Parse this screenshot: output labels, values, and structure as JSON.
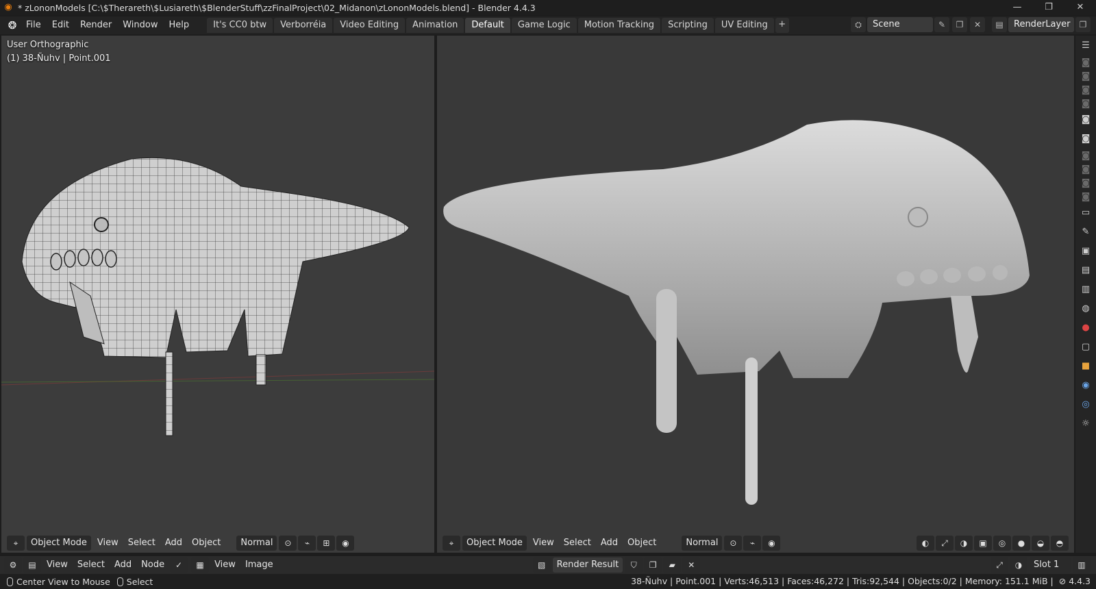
{
  "window": {
    "title": "* zLononModels [C:\\$Therareth\\$Lusiareth\\$BlenderStuff\\zzFinalProject\\02_Midanon\\zLononModels.blend] - Blender 4.4.3",
    "controls": [
      "—",
      "❐",
      "✕"
    ]
  },
  "menu": {
    "items": [
      "File",
      "Edit",
      "Render",
      "Window",
      "Help"
    ]
  },
  "workspaces": {
    "tabs": [
      "It's CC0 btw",
      "Verborréia",
      "Video Editing",
      "Animation",
      "Default",
      "Game Logic",
      "Motion Tracking",
      "Scripting",
      "UV Editing"
    ],
    "active": "Default",
    "add_label": "+"
  },
  "scene": {
    "name": "Scene"
  },
  "render_layer": {
    "name": "RenderLayer"
  },
  "viewport_left": {
    "view_name": "User Orthographic",
    "object_info": "(1) 38-Ñuhv | Point.001",
    "mode": "Object Mode",
    "menus": [
      "View",
      "Select",
      "Add",
      "Object"
    ],
    "orientation": "Normal"
  },
  "viewport_right": {
    "mode": "Object Mode",
    "menus": [
      "View",
      "Select",
      "Add",
      "Object"
    ],
    "orientation": "Normal"
  },
  "editor_bar": {
    "node_menus": [
      "View",
      "Select",
      "Add",
      "Node"
    ],
    "image_menus": [
      "View",
      "Image"
    ],
    "render_result": "Render Result",
    "slot": "Slot 1"
  },
  "status": {
    "left_action": "Center View to Mouse",
    "right_action": "Select",
    "info": "38-Ñuhv | Point.001 | Verts:46,513 | Faces:46,272 | Tris:92,544 | Objects:0/2 | Memory: 151.1 MiB | ",
    "version": "4.4.3"
  },
  "colors": {
    "accent": "#e87d0d",
    "grid_x": "#8a3a3a",
    "grid_y": "#4d7a2e"
  }
}
